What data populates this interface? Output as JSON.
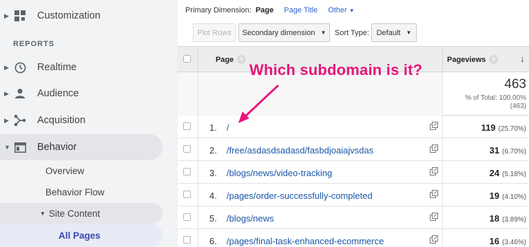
{
  "sidebar": {
    "customization": "Customization",
    "reports_header": "REPORTS",
    "items": [
      {
        "label": "Realtime",
        "icon": "clock-icon"
      },
      {
        "label": "Audience",
        "icon": "person-icon"
      },
      {
        "label": "Acquisition",
        "icon": "acquisition-icon"
      },
      {
        "label": "Behavior",
        "icon": "behavior-icon"
      }
    ],
    "behavior_sub": {
      "overview": "Overview",
      "behavior_flow": "Behavior Flow",
      "site_content": "Site Content",
      "all_pages": "All Pages"
    }
  },
  "toolbar": {
    "primary_dimension_label": "Primary Dimension:",
    "dim_page": "Page",
    "dim_page_title": "Page Title",
    "dim_other": "Other",
    "plot_rows": "Plot Rows",
    "secondary_dimension": "Secondary dimension",
    "sort_type_label": "Sort Type:",
    "sort_type_value": "Default"
  },
  "table": {
    "col_page": "Page",
    "col_pageviews": "Pageviews",
    "total_value": "463",
    "total_pct_line1": "% of Total: 100.00%",
    "total_pct_line2": "(463)",
    "rows": [
      {
        "num": "1.",
        "page": "/",
        "value": "119",
        "pct": "(25.70%)"
      },
      {
        "num": "2.",
        "page": "/free/asdasdsadasd/fasbdjoaiajvsdas",
        "value": "31",
        "pct": "(6.70%)"
      },
      {
        "num": "3.",
        "page": "/blogs/news/video-tracking",
        "value": "24",
        "pct": "(5.18%)"
      },
      {
        "num": "4.",
        "page": "/pages/order-successfully-completed",
        "value": "19",
        "pct": "(4.10%)"
      },
      {
        "num": "5.",
        "page": "/blogs/news",
        "value": "18",
        "pct": "(3.89%)"
      },
      {
        "num": "6.",
        "page": "/pages/final-task-enhanced-ecommerce",
        "value": "16",
        "pct": "(3.46%)"
      }
    ]
  },
  "annotation": {
    "text": "Which subdomain is it?",
    "color": "#e8157a"
  },
  "colors": {
    "link": "#1a55a6",
    "active_nav": "#3949ab"
  }
}
